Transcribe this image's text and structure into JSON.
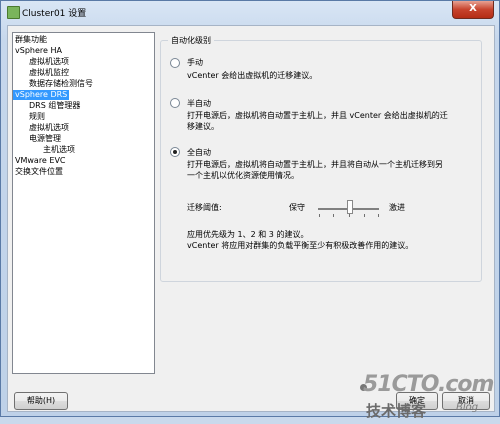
{
  "window": {
    "title": "Cluster01 设置",
    "close_label": "X"
  },
  "nav": {
    "items": [
      {
        "label": "群集功能",
        "level": 0
      },
      {
        "label": "vSphere HA",
        "level": 0
      },
      {
        "label": "虚拟机选项",
        "level": 1
      },
      {
        "label": "虚拟机监控",
        "level": 1
      },
      {
        "label": "数据存储检测信号",
        "level": 1
      },
      {
        "label": "vSphere DRS",
        "level": 0,
        "selected": true
      },
      {
        "label": "DRS 组管理器",
        "level": 1
      },
      {
        "label": "规则",
        "level": 1
      },
      {
        "label": "虚拟机选项",
        "level": 1
      },
      {
        "label": "电源管理",
        "level": 1
      },
      {
        "label": "主机选项",
        "level": 2
      },
      {
        "label": "VMware EVC",
        "level": 0
      },
      {
        "label": "交换文件位置",
        "level": 0
      }
    ]
  },
  "automation": {
    "group_title": "自动化级别",
    "options": [
      {
        "title": "手动",
        "desc": [
          "vCenter 会给出虚拟机的迁移建议。"
        ],
        "checked": false
      },
      {
        "title": "半自动",
        "desc": [
          "打开电源后，虚拟机将自动置于主机上，并且 vCenter 会给出虚拟机的迁",
          "移建议。"
        ],
        "checked": false
      },
      {
        "title": "全自动",
        "desc": [
          "打开电源后，虚拟机将自动置于主机上，并且将自动从一个主机迁移到另",
          "一个主机以优化资源使用情况。"
        ],
        "checked": true
      }
    ],
    "threshold_label": "迁移阈值:",
    "conservative_label": "保守",
    "aggressive_label": "激进",
    "threshold_level": 3,
    "threshold_levels": 5,
    "note_line1": "应用优先级为 1、2 和 3 的建议。",
    "note_line2": "vCenter 将应用对群集的负载平衡至少有积极改善作用的建议。"
  },
  "buttons": {
    "help": "帮助(H)",
    "ok": "确定",
    "cancel": "取消"
  },
  "watermark": {
    "main": "51CTO.com",
    "sub": "技术博客",
    "blog": "Blog"
  }
}
